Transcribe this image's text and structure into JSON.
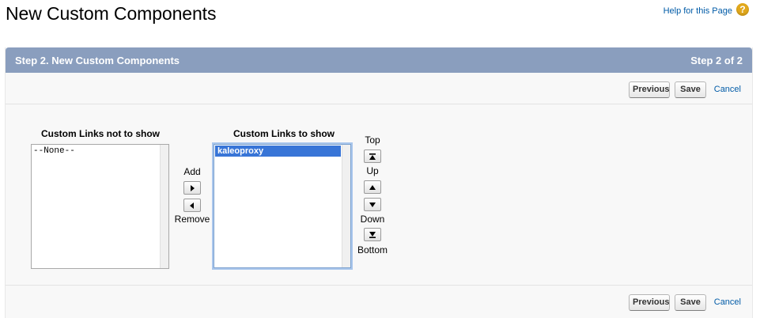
{
  "header": {
    "title": "New Custom Components",
    "help_link": "Help for this Page",
    "help_icon": "?"
  },
  "step": {
    "title": "Step 2. New Custom Components",
    "count": "Step 2 of 2"
  },
  "buttons": {
    "previous": "Previous",
    "save": "Save",
    "cancel": "Cancel"
  },
  "available": {
    "label": "Custom Links not to show",
    "options": [
      "--None--"
    ]
  },
  "selected": {
    "label": "Custom Links to show",
    "options": [
      "kaleoproxy"
    ],
    "selected_value": "kaleoproxy"
  },
  "move": {
    "add": "Add",
    "remove": "Remove"
  },
  "order": {
    "top": "Top",
    "up": "Up",
    "down": "Down",
    "bottom": "Bottom"
  },
  "colors": {
    "header_bar": "#8a9ebe",
    "link": "#015ba7",
    "selection": "#3875d7",
    "help_icon": "#e1a81c"
  }
}
